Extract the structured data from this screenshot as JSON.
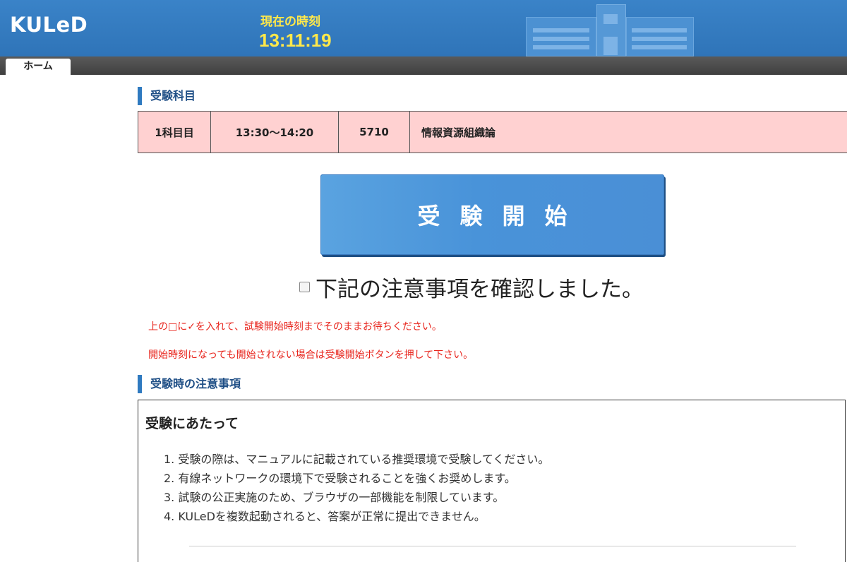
{
  "header": {
    "logo": "KULeD",
    "clock_label": "現在の時刻",
    "clock_time": "13:11:19"
  },
  "nav": {
    "tabs": [
      {
        "label": "ホーム"
      }
    ]
  },
  "subject_section": {
    "heading": "受験科目",
    "row": {
      "period": "1科目目",
      "time": "13:30〜14:20",
      "code": "5710",
      "name": "情報資源組織論"
    },
    "row_color": "#ffd1d1"
  },
  "start_button": {
    "label": "受験開始",
    "color": "#4a93d8"
  },
  "confirm": {
    "label": "下記の注意事項を確認しました。",
    "checked": false
  },
  "notes": [
    "上の□に✓を入れて、試験開始時刻までそのままお待ちください。",
    "開始時刻になっても開始されない場合は受験開始ボタンを押して下さい。"
  ],
  "notes_color": "#e8251d",
  "precautions": {
    "heading": "受験時の注意事項",
    "title": "受験にあたって",
    "items": [
      "1. 受験の際は、マニュアルに記載されている推奨環境で受験してください。",
      "2. 有線ネットワークの環境下で受験されることを強くお奨めします。",
      "3. 試験の公正実施のため、ブラウザの一部機能を制限しています。",
      "4. KULeDを複数起動されると、答案が正常に提出できません。"
    ]
  },
  "colors": {
    "header_blue": "#3a83c8",
    "clock_yellow": "#ffe84a",
    "heading_accent": "#2f7ac0"
  }
}
